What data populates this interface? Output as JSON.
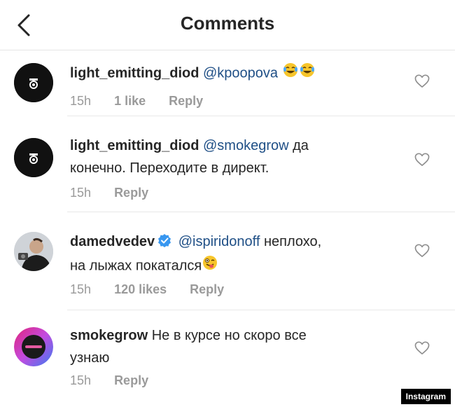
{
  "header": {
    "title": "Comments"
  },
  "comments": [
    {
      "username": "light_emitting_diod",
      "mention": "@kpoopova",
      "text": "",
      "emoji": [
        "tears-of-joy",
        "tears-of-joy"
      ],
      "time": "15h",
      "likes": "1 like",
      "reply": "Reply"
    },
    {
      "username": "light_emitting_diod",
      "mention": "@smokegrow",
      "text": "да",
      "text2": "конечно. Переходите в директ.",
      "time": "15h",
      "reply": "Reply"
    },
    {
      "username": "damedvedev",
      "mention": "@ispiridonoff",
      "text": "неплохо,",
      "text2": "на лыжах покатался",
      "emoji": [
        "winking-tongue"
      ],
      "time": "15h",
      "likes": "120 likes",
      "reply": "Reply"
    },
    {
      "username": "smokegrow",
      "text": "Не в курсе но скоро все",
      "text2": "узнаю",
      "time": "15h",
      "reply": "Reply"
    }
  ],
  "watermark": "Instagram",
  "colors": {
    "mention": "#1f4f86",
    "meta": "#9a9a9a",
    "verified": "#3897f0"
  }
}
